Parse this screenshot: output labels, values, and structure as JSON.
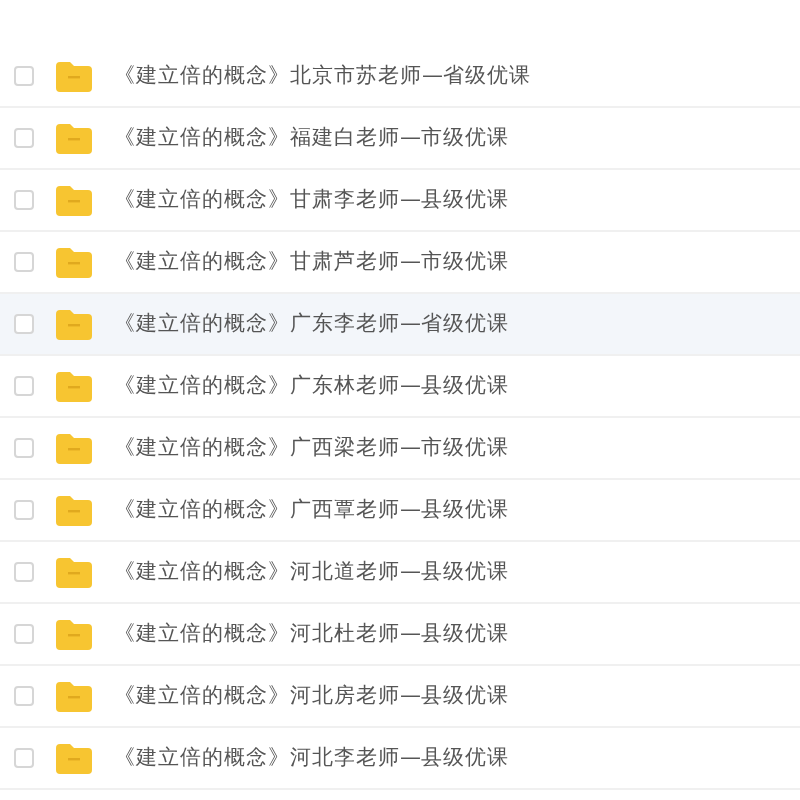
{
  "files": [
    {
      "name": "《建立倍的概念》北京市苏老师—省级优课",
      "selected": false,
      "checked": false
    },
    {
      "name": "《建立倍的概念》福建白老师—市级优课",
      "selected": false,
      "checked": false
    },
    {
      "name": "《建立倍的概念》甘肃李老师—县级优课",
      "selected": false,
      "checked": false
    },
    {
      "name": "《建立倍的概念》甘肃芦老师—市级优课",
      "selected": false,
      "checked": false
    },
    {
      "name": "《建立倍的概念》广东李老师—省级优课",
      "selected": true,
      "checked": false
    },
    {
      "name": "《建立倍的概念》广东林老师—县级优课",
      "selected": false,
      "checked": false
    },
    {
      "name": "《建立倍的概念》广西梁老师—市级优课",
      "selected": false,
      "checked": false
    },
    {
      "name": "《建立倍的概念》广西覃老师—县级优课",
      "selected": false,
      "checked": false
    },
    {
      "name": "《建立倍的概念》河北道老师—县级优课",
      "selected": false,
      "checked": false
    },
    {
      "name": "《建立倍的概念》河北杜老师—县级优课",
      "selected": false,
      "checked": false
    },
    {
      "name": "《建立倍的概念》河北房老师—县级优课",
      "selected": false,
      "checked": false
    },
    {
      "name": "《建立倍的概念》河北李老师—县级优课",
      "selected": false,
      "checked": false
    }
  ]
}
